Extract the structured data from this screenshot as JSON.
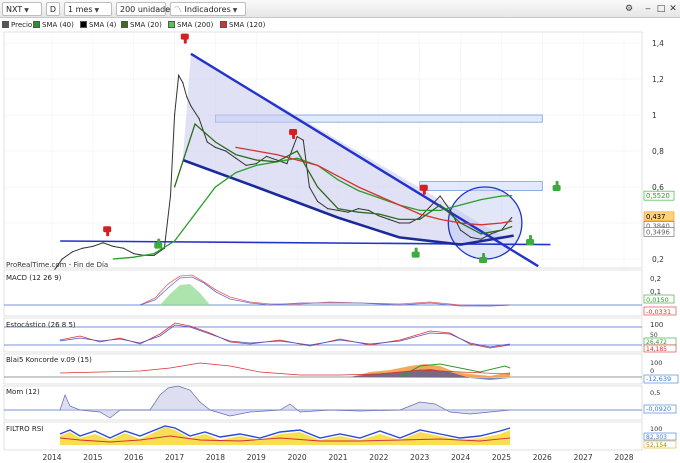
{
  "toolbar": {
    "symbol": "NXT",
    "d_label": "D",
    "period": "1 mes",
    "units": "200 unidades",
    "indicators": "Indicadores"
  },
  "legend": [
    {
      "label": "Precio",
      "color": "#5a5a5a"
    },
    {
      "label": "SMA (40)",
      "color": "#1f9a2a"
    },
    {
      "label": "SMA (4)",
      "color": "#000000"
    },
    {
      "label": "SMA (20)",
      "color": "#3a6e1a"
    },
    {
      "label": "SMA (200)",
      "color": "#4fc84f"
    },
    {
      "label": "SMA (120)",
      "color": "#d93030"
    }
  ],
  "source_label": "ProRealTime.com - Fin de Día",
  "panels": {
    "macd": {
      "title": "MACD (12 26 9)",
      "ticks": [
        "0,2",
        "0,1",
        "0",
        "-0,1"
      ],
      "values": [
        "0,0150",
        "-0,0331"
      ]
    },
    "stoch": {
      "title": "Estocástico (26 8 5)",
      "ticks": [
        "100",
        "50",
        "0"
      ],
      "values": [
        "26,472",
        "14,185"
      ]
    },
    "koncorde": {
      "title": "Blai5 Koncorde v.09 (15)",
      "ticks": [
        "100",
        "0"
      ],
      "values": [
        "-12,639"
      ]
    },
    "mom": {
      "title": "Mom (12)",
      "ticks": [
        "0,5"
      ],
      "values": [
        "-0,0920"
      ]
    },
    "rsi": {
      "title": "FILTRO RSI",
      "ticks": [
        "100"
      ],
      "values": [
        "82,303",
        "52,154"
      ]
    }
  },
  "chart_data": {
    "type": "line",
    "title": "NXT",
    "x_labels": [
      "2014",
      "2015",
      "2016",
      "2017",
      "2018",
      "2019",
      "2020",
      "2021",
      "2022",
      "2023",
      "2024",
      "2025",
      "2026",
      "2027",
      "2028"
    ],
    "y_ticks": [
      "1,4",
      "1,2",
      "1",
      "0,8",
      "0,6",
      "0,4",
      "0,2"
    ],
    "y_values_ticks": [
      1.4,
      1.2,
      1.0,
      0.8,
      0.6,
      0.4,
      0.2
    ],
    "xlim": [
      2014.0,
      2028.25
    ],
    "ylim": [
      0.1,
      1.48
    ],
    "price_labels": [
      {
        "text": "0,5520",
        "value": 0.552,
        "color": "#22aa22"
      },
      {
        "text": "0,437",
        "value": 0.437,
        "color": "#ff9900"
      },
      {
        "text": "0,3840",
        "value": 0.384,
        "color": "#666666"
      },
      {
        "text": "0,3496",
        "value": 0.3496,
        "color": "#666666"
      }
    ],
    "series": [
      {
        "name": "Precio",
        "color": "#333333",
        "x": [
          2014.0,
          2014.25,
          2014.5,
          2014.75,
          2015.0,
          2015.25,
          2015.5,
          2015.75,
          2016.0,
          2016.25,
          2016.5,
          2016.75,
          2016.9,
          2017.0,
          2017.1,
          2017.2,
          2017.3,
          2017.4,
          2017.6,
          2017.8,
          2018.0,
          2018.25,
          2018.5,
          2018.75,
          2019.0,
          2019.25,
          2019.5,
          2019.75,
          2020.0,
          2020.15,
          2020.3,
          2020.5,
          2020.75,
          2021.0,
          2021.25,
          2021.5,
          2021.75,
          2022.0,
          2022.25,
          2022.5,
          2022.75,
          2023.0,
          2023.25,
          2023.5,
          2023.75,
          2024.0,
          2024.25,
          2024.5,
          2024.75,
          2025.0,
          2025.25
        ],
        "y": [
          0.12,
          0.2,
          0.24,
          0.26,
          0.27,
          0.29,
          0.27,
          0.26,
          0.23,
          0.22,
          0.22,
          0.26,
          0.55,
          1.0,
          1.22,
          1.18,
          1.1,
          1.05,
          0.98,
          0.85,
          0.82,
          0.8,
          0.76,
          0.72,
          0.73,
          0.77,
          0.75,
          0.73,
          0.88,
          0.86,
          0.6,
          0.52,
          0.48,
          0.47,
          0.46,
          0.48,
          0.47,
          0.44,
          0.42,
          0.4,
          0.4,
          0.43,
          0.49,
          0.55,
          0.47,
          0.36,
          0.32,
          0.31,
          0.34,
          0.36,
          0.43
        ]
      },
      {
        "name": "SMA (40)",
        "color": "#2a9d2a",
        "x": [
          2015.5,
          2016.0,
          2016.5,
          2017.0,
          2017.5,
          2018.0,
          2018.5,
          2019.0,
          2019.5,
          2020.0,
          2020.5,
          2021.0,
          2021.5,
          2022.0,
          2022.5,
          2023.0,
          2023.5,
          2024.0,
          2024.5,
          2025.0,
          2025.25
        ],
        "y": [
          0.2,
          0.21,
          0.23,
          0.3,
          0.45,
          0.6,
          0.68,
          0.72,
          0.74,
          0.76,
          0.72,
          0.64,
          0.58,
          0.54,
          0.5,
          0.47,
          0.47,
          0.5,
          0.53,
          0.55,
          0.552
        ]
      },
      {
        "name": "SMA (120)",
        "color": "#d93030",
        "x": [
          2018.5,
          2019.0,
          2019.5,
          2020.0,
          2020.5,
          2021.0,
          2021.5,
          2022.0,
          2022.5,
          2023.0,
          2023.5,
          2024.0,
          2024.5,
          2025.0,
          2025.25
        ],
        "y": [
          0.82,
          0.8,
          0.78,
          0.75,
          0.72,
          0.66,
          0.6,
          0.55,
          0.5,
          0.45,
          0.42,
          0.4,
          0.39,
          0.4,
          0.41
        ]
      },
      {
        "name": "SMA (20)",
        "color": "#2f6b1e",
        "x": [
          2017.0,
          2017.5,
          2018.0,
          2018.5,
          2019.0,
          2019.5,
          2020.0,
          2020.5,
          2021.0,
          2021.5,
          2022.0,
          2022.5,
          2023.0,
          2023.5,
          2024.0,
          2024.5,
          2025.0,
          2025.25
        ],
        "y": [
          0.6,
          0.95,
          0.85,
          0.78,
          0.75,
          0.74,
          0.8,
          0.6,
          0.48,
          0.46,
          0.45,
          0.42,
          0.42,
          0.5,
          0.4,
          0.34,
          0.36,
          0.38
        ]
      }
    ],
    "annotations": {
      "downtrend_line": {
        "from": [
          2017.4,
          1.34
        ],
        "to": [
          2025.9,
          0.16
        ]
      },
      "support_line": {
        "from": [
          2014.2,
          0.3
        ],
        "to": [
          2026.2,
          0.28
        ]
      },
      "arc_curve": [
        [
          2017.2,
          0.75
        ],
        [
          2019.0,
          0.6
        ],
        [
          2021.0,
          0.43
        ],
        [
          2022.5,
          0.32
        ],
        [
          2024.0,
          0.28
        ],
        [
          2025.3,
          0.33
        ]
      ],
      "resistance_zones": [
        {
          "x0": 2018.0,
          "x1": 2026.0,
          "y0": 0.96,
          "y1": 1.0
        },
        {
          "x0": 2023.0,
          "x1": 2026.0,
          "y0": 0.58,
          "y1": 0.63
        }
      ],
      "circle": {
        "cx": 2024.6,
        "cy": 0.4,
        "rx": 0.9,
        "ry": 0.2
      },
      "thumbs_down": [
        [
          2015.35,
          0.36
        ],
        [
          2017.25,
          1.43
        ],
        [
          2019.9,
          0.9
        ],
        [
          2023.1,
          0.59
        ]
      ],
      "thumbs_up": [
        [
          2016.6,
          0.28
        ],
        [
          2022.9,
          0.23
        ],
        [
          2024.55,
          0.2
        ],
        [
          2025.7,
          0.3
        ],
        [
          2026.35,
          0.6
        ]
      ]
    }
  }
}
